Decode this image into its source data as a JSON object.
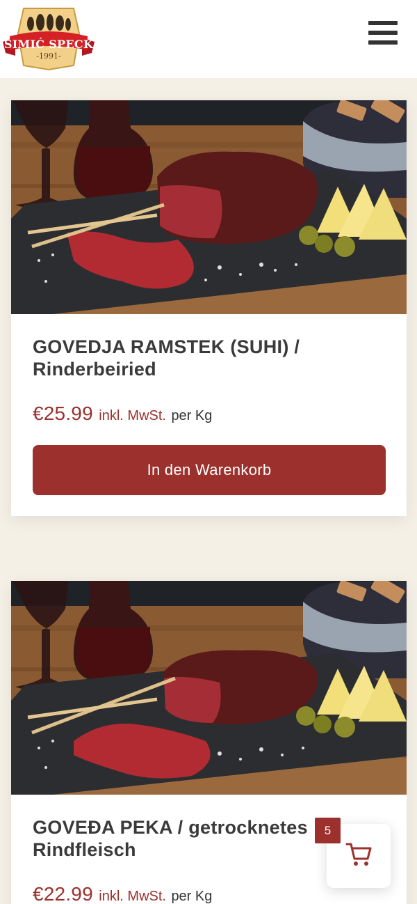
{
  "header": {
    "logo_text": "ŠIMIĆ SPECK",
    "logo_year": "-1991-",
    "menu_icon": "hamburger-icon"
  },
  "products": [
    {
      "title": "GOVEDJA RAMSTEK (SUHI) / Rinderbeiried",
      "price": "€25.99",
      "tax_label": "inkl. MwSt.",
      "unit": "per Kg",
      "button_label": "In den Warenkorb"
    },
    {
      "title": "GOVEĐA PEKA / getrocknetes Rindfleisch",
      "price": "€22.99",
      "tax_label": "inkl. MwSt.",
      "unit": "per Kg"
    }
  ],
  "cart": {
    "count": "5",
    "icon": "shopping-cart-icon"
  },
  "colors": {
    "accent": "#9c302c",
    "background": "#f5f0e6",
    "text": "#3a3a3a"
  }
}
